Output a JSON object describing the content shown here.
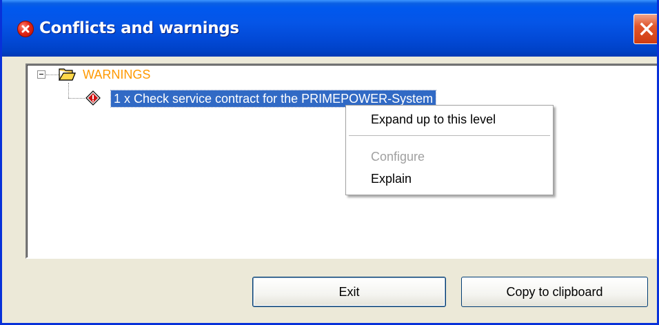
{
  "window": {
    "title": "Conflicts and warnings",
    "title_icon": "error-icon",
    "close_icon": "close-icon"
  },
  "tree": {
    "root": {
      "label": "WARNINGS",
      "icon": "folder-open-icon",
      "expanded": true,
      "color": "#ff9900"
    },
    "items": [
      {
        "label": "1 x Check service contract for the PRIMEPOWER-System",
        "icon": "warning-diamond-icon",
        "selected": true
      }
    ]
  },
  "context_menu": {
    "items": [
      {
        "label": "Expand up to this level",
        "enabled": true
      },
      {
        "separator": true
      },
      {
        "label": "Configure",
        "enabled": false
      },
      {
        "label": "Explain",
        "enabled": true
      }
    ]
  },
  "buttons": {
    "exit": "Exit",
    "copy": "Copy to clipboard"
  },
  "colors": {
    "selection": "#316ac5",
    "titlebar": "#0058ee",
    "dialog_bg": "#ece9d8",
    "warning_label": "#ff9900"
  }
}
